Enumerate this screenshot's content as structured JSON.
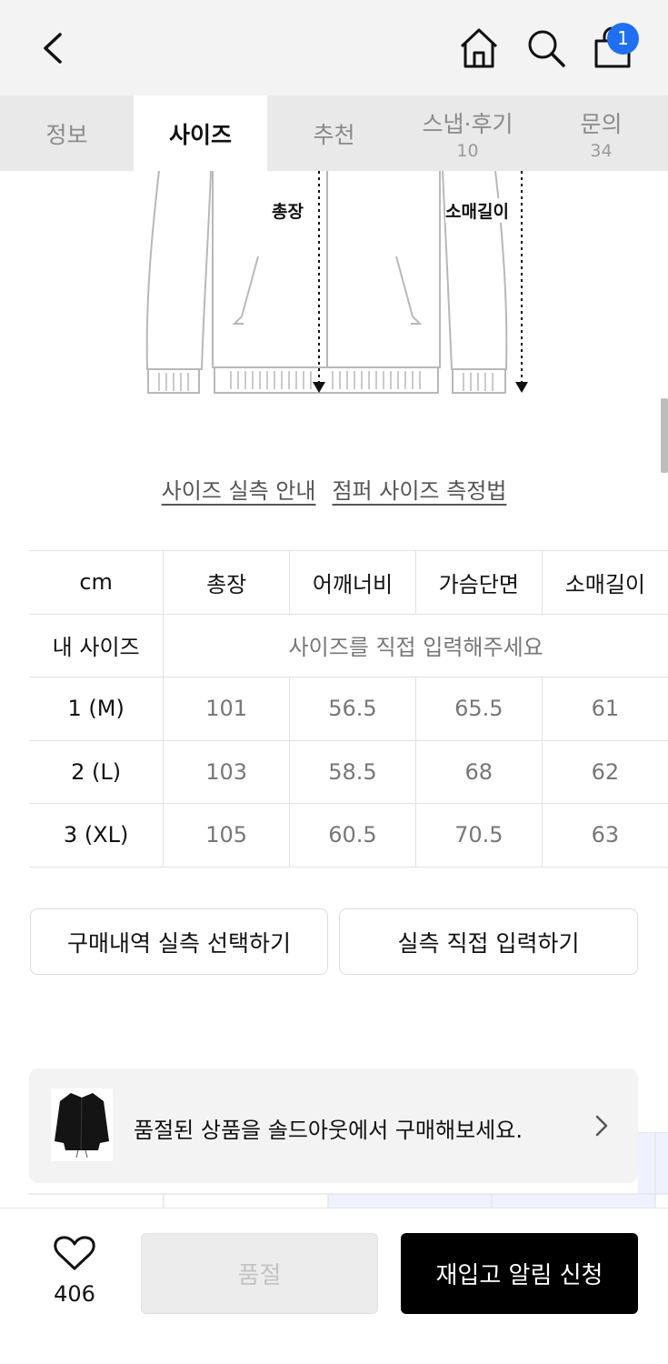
{
  "header": {
    "back_icon": "chevron-left-icon",
    "home_icon": "home-icon",
    "search_icon": "search-icon",
    "cart_icon": "shopping-bag-icon",
    "cart_count": "1",
    "badge_color": "#1f6ff2"
  },
  "tabs": [
    {
      "label": "정보",
      "count": ""
    },
    {
      "label": "사이즈",
      "count": ""
    },
    {
      "label": "추천",
      "count": ""
    },
    {
      "label": "스냅·후기",
      "count": "10"
    },
    {
      "label": "문의",
      "count": "34"
    }
  ],
  "illustration": {
    "total_length_label": "총장",
    "sleeve_length_label": "소매길이"
  },
  "links": {
    "guide": "사이즈 실측 안내",
    "measure": "점퍼 사이즈 측정법"
  },
  "size_table": {
    "headers": [
      "cm",
      "총장",
      "어깨너비",
      "가슴단면",
      "소매길이"
    ],
    "my_size_label": "내 사이즈",
    "my_size_placeholder": "사이즈를 직접 입력해주세요",
    "rows": [
      {
        "size": "1 (M)",
        "values": [
          "101",
          "56.5",
          "65.5",
          "61"
        ]
      },
      {
        "size": "2 (L)",
        "values": [
          "103",
          "58.5",
          "68",
          "62"
        ]
      },
      {
        "size": "3 (XL)",
        "values": [
          "105",
          "60.5",
          "70.5",
          "63"
        ]
      }
    ]
  },
  "actions": {
    "select_purchase": "구매내역 실측 선택하기",
    "direct_input": "실측 직접 입력하기"
  },
  "banner": {
    "text": "품절된 상품을 솔드아웃에서 구매해보세요."
  },
  "bottom_bar": {
    "like_count": "406",
    "soldout_label": "품절",
    "notify_label": "재입고 알림 신청"
  }
}
